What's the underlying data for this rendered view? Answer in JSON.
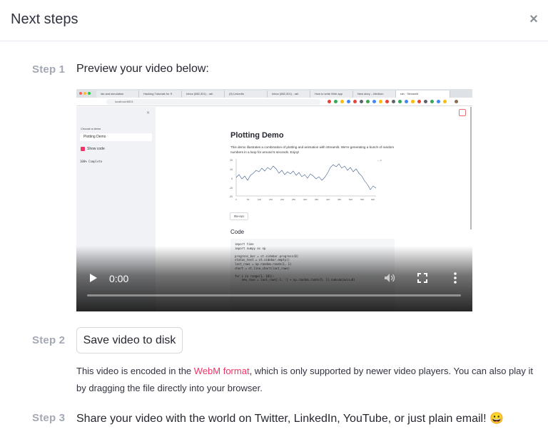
{
  "header": {
    "title": "Next steps",
    "close_symbol": "×"
  },
  "steps": [
    {
      "label": "Step 1",
      "text": "Preview your video below:"
    },
    {
      "label": "Step 2",
      "button": "Save video to disk"
    },
    {
      "label": "Step 3",
      "text": "Share your video with the world on Twitter, LinkedIn, YouTube, or just plain email! 😀"
    }
  ],
  "note": {
    "before": "This video is encoded in the ",
    "link": "WebM format",
    "after": ", which is only supported by newer video players. You can also play it by dragging the file directly into your browser."
  },
  "video": {
    "time": "0:00",
    "progress": 0,
    "icons": {
      "play": "play-icon",
      "volume": "volume-icon",
      "fullscreen": "fullscreen-icon",
      "more": "more-options-icon"
    },
    "frame": {
      "tabs": [
        "ide.and.simulation",
        "Hacking Tutorials for S",
        "Inbox (882,301) - rah",
        "(9) LinkedIn",
        "Inbox (882,301) - rah",
        "How to write Web app",
        "New story – Medium",
        "rah · Streamlit"
      ],
      "url": "localhost:8501",
      "sidebar": {
        "label": "Choose a demo",
        "selected": "Plotting Demo",
        "checkbox": "Show code",
        "progress": "100% Complete"
      },
      "main": {
        "title": "Plotting Demo",
        "description": "This demo illustrates a combination of plotting and animation with Streamlit. We're generating a bunch of random numbers in a loop for around 5 seconds. Enjoy!",
        "rerun": "Re-run",
        "code_heading": "Code",
        "code": "import time\nimport numpy as np\n\nprogress_bar = st.sidebar.progress(0)\nstatus_text = st.sidebar.empty()\nlast_rows = np.random.randn(1, 1)\nchart = st.line_chart(last_rows)\n\nfor i in range(1, 101):\n    new_rows = last_rows[-1, :] + np.random.randn(5, 1).cumsum(axis=0)",
        "chart_y_ticks": [
          "20",
          "10",
          "0",
          "-10",
          "-20"
        ],
        "chart_x_ticks": [
          "0",
          "50",
          "100",
          "150",
          "200",
          "250",
          "300",
          "350",
          "400",
          "450",
          "500",
          "550",
          "600"
        ]
      }
    }
  },
  "colors": {
    "accent": "#f63366",
    "step_label": "#a3a8b4",
    "text": "#262730"
  }
}
